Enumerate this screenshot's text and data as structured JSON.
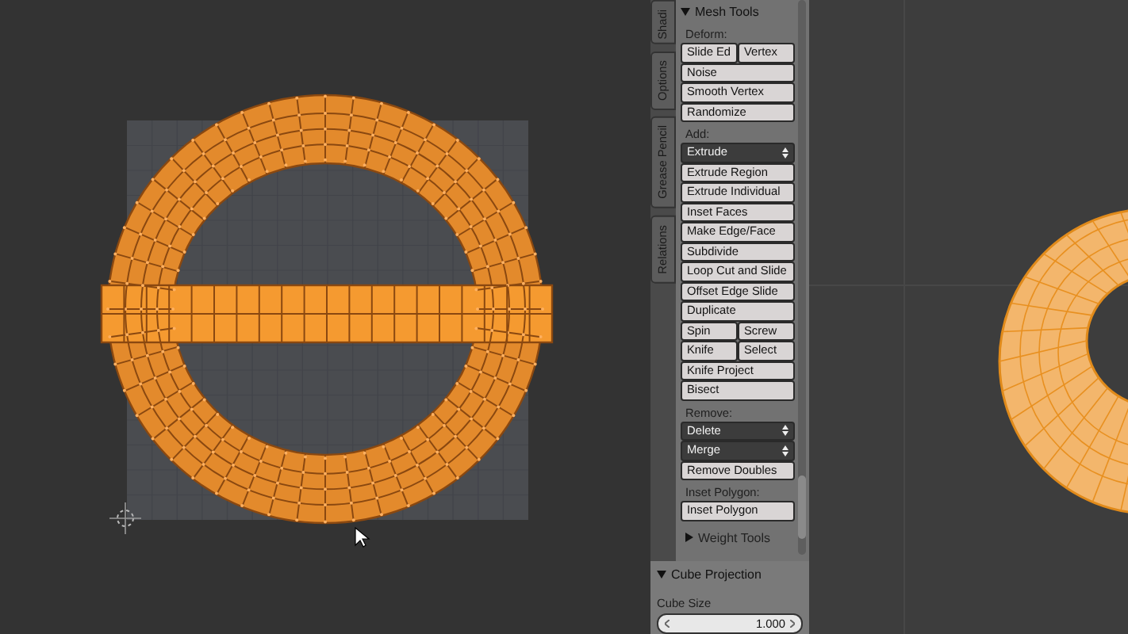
{
  "tabs": [
    {
      "label": "Shadi",
      "selected": false
    },
    {
      "label": "Options",
      "selected": false
    },
    {
      "label": "Grease Pencil",
      "selected": false
    },
    {
      "label": "Relations",
      "selected": false
    }
  ],
  "mesh_tools": {
    "title": "Mesh Tools",
    "expanded": true,
    "groups": [
      {
        "label": "Deform:",
        "rows": [
          [
            {
              "kind": "button",
              "text": "Slide Ed"
            },
            {
              "kind": "button",
              "text": "Vertex"
            }
          ],
          [
            {
              "kind": "button",
              "text": "Noise"
            }
          ],
          [
            {
              "kind": "button",
              "text": "Smooth Vertex"
            }
          ],
          [
            {
              "kind": "button",
              "text": "Randomize"
            }
          ]
        ]
      },
      {
        "label": "Add:",
        "rows": [
          [
            {
              "kind": "dropdown",
              "text": "Extrude"
            }
          ],
          [
            {
              "kind": "button",
              "text": "Extrude Region"
            }
          ],
          [
            {
              "kind": "button",
              "text": "Extrude Individual"
            }
          ],
          [
            {
              "kind": "button",
              "text": "Inset Faces"
            }
          ],
          [
            {
              "kind": "button",
              "text": "Make Edge/Face"
            }
          ],
          [
            {
              "kind": "button",
              "text": "Subdivide"
            }
          ],
          [
            {
              "kind": "button",
              "text": "Loop Cut and Slide"
            }
          ],
          [
            {
              "kind": "button",
              "text": "Offset Edge Slide"
            }
          ],
          [
            {
              "kind": "button",
              "text": "Duplicate"
            }
          ],
          [
            {
              "kind": "button",
              "text": "Spin"
            },
            {
              "kind": "button",
              "text": "Screw"
            }
          ],
          [
            {
              "kind": "button",
              "text": "Knife"
            },
            {
              "kind": "button",
              "text": "Select"
            }
          ],
          [
            {
              "kind": "button",
              "text": "Knife Project"
            }
          ],
          [
            {
              "kind": "button",
              "text": "Bisect"
            }
          ]
        ]
      },
      {
        "label": "Remove:",
        "rows": [
          [
            {
              "kind": "dropdown",
              "text": "Delete"
            }
          ],
          [
            {
              "kind": "dropdown",
              "text": "Merge"
            }
          ],
          [
            {
              "kind": "button",
              "text": "Remove Doubles"
            }
          ]
        ]
      },
      {
        "label": "Inset Polygon:",
        "rows": [
          [
            {
              "kind": "button",
              "text": "Inset Polygon"
            }
          ]
        ]
      }
    ]
  },
  "weight_tools": {
    "title": "Weight Tools",
    "expanded": false
  },
  "cube_projection": {
    "title": "Cube Projection",
    "expanded": true,
    "field": {
      "label": "Cube Size",
      "value": "1.000"
    }
  }
}
